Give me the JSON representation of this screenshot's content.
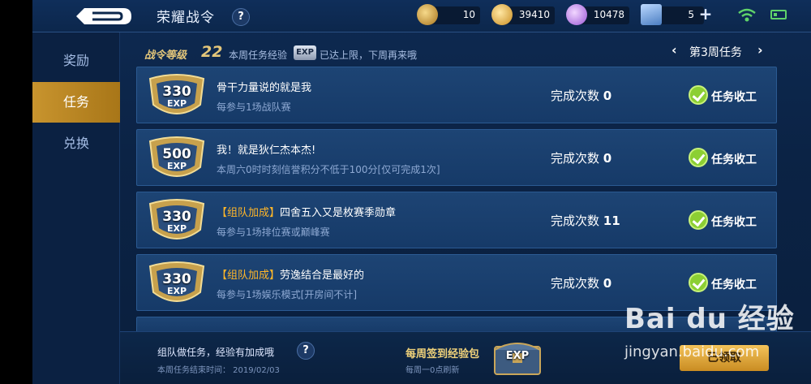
{
  "header": {
    "title": "荣耀战令",
    "help": "?",
    "resources": [
      {
        "icon": "feather-icon",
        "value": "10"
      },
      {
        "icon": "gold-coin-icon",
        "value": "39410"
      },
      {
        "icon": "diamond-icon",
        "value": "10478"
      },
      {
        "icon": "card-icon",
        "value": "5"
      }
    ],
    "plus": "+"
  },
  "sidebar": {
    "items": [
      {
        "label": "奖励"
      },
      {
        "label": "任务"
      },
      {
        "label": "兑换"
      }
    ]
  },
  "level": {
    "label": "战令等级",
    "value": "22",
    "exp_text": "本周任务经验",
    "exp_badge": "EXP",
    "limit_text": "已达上限，下周再来哦"
  },
  "week": {
    "prev": "‹",
    "label": "第3周任务",
    "next": "›"
  },
  "tasks": [
    {
      "exp": "330",
      "exp_unit": "EXP",
      "bonus": "",
      "name": "骨干力量说的就是我",
      "desc": "每参与1场战队赛",
      "count_label": "完成次数",
      "count": "0",
      "status": "任务收工"
    },
    {
      "exp": "500",
      "exp_unit": "EXP",
      "bonus": "",
      "name": "我！就是狄仁杰本杰!",
      "desc": "本周六0时时刻信誉积分不低于100分[仅可完成1次]",
      "count_label": "完成次数",
      "count": "0",
      "status": "任务收工"
    },
    {
      "exp": "330",
      "exp_unit": "EXP",
      "bonus": "【组队加成】",
      "name": "四舍五入又是枚赛季勋章",
      "desc": "每参与1场排位赛或巅峰赛",
      "count_label": "完成次数",
      "count": "11",
      "status": "任务收工"
    },
    {
      "exp": "330",
      "exp_unit": "EXP",
      "bonus": "【组队加成】",
      "name": "劳逸结合是最好的",
      "desc": "每参与1场娱乐模式[开房间不计]",
      "count_label": "完成次数",
      "count": "0",
      "status": "任务收工"
    }
  ],
  "footer": {
    "team_tip": "组队做任务，经验有加成哦",
    "help": "?",
    "end_time": "本周任务结束时间：  2019/02/03",
    "sign_title": "每周签到经验包",
    "sign_sub": "每周一0点刷新",
    "chest_label": "EXP",
    "claim_label": "已领取"
  },
  "watermark": {
    "logo": "Bai du 经验",
    "url": "jingyan.baidu.com"
  },
  "colors": {
    "accent_gold": "#c8942e",
    "bonus": "#ffb629",
    "check": "#8ccf33"
  }
}
